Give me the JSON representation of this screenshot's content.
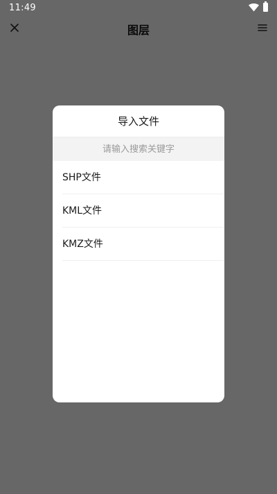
{
  "status_bar": {
    "time": "11:49"
  },
  "header": {
    "title": "图层"
  },
  "dialog": {
    "title": "导入文件",
    "search": {
      "value": "",
      "placeholder": "请输入搜索关键字"
    },
    "items": [
      {
        "label": "SHP文件"
      },
      {
        "label": "KML文件"
      },
      {
        "label": "KMZ文件"
      }
    ]
  },
  "icons": {
    "close": "close-icon",
    "menu": "menu-icon",
    "wifi": "wifi-icon",
    "battery": "battery-icon"
  },
  "colors": {
    "overlay": "#676767",
    "dialog_bg": "#ffffff",
    "search_bg": "#f3f3f3"
  }
}
